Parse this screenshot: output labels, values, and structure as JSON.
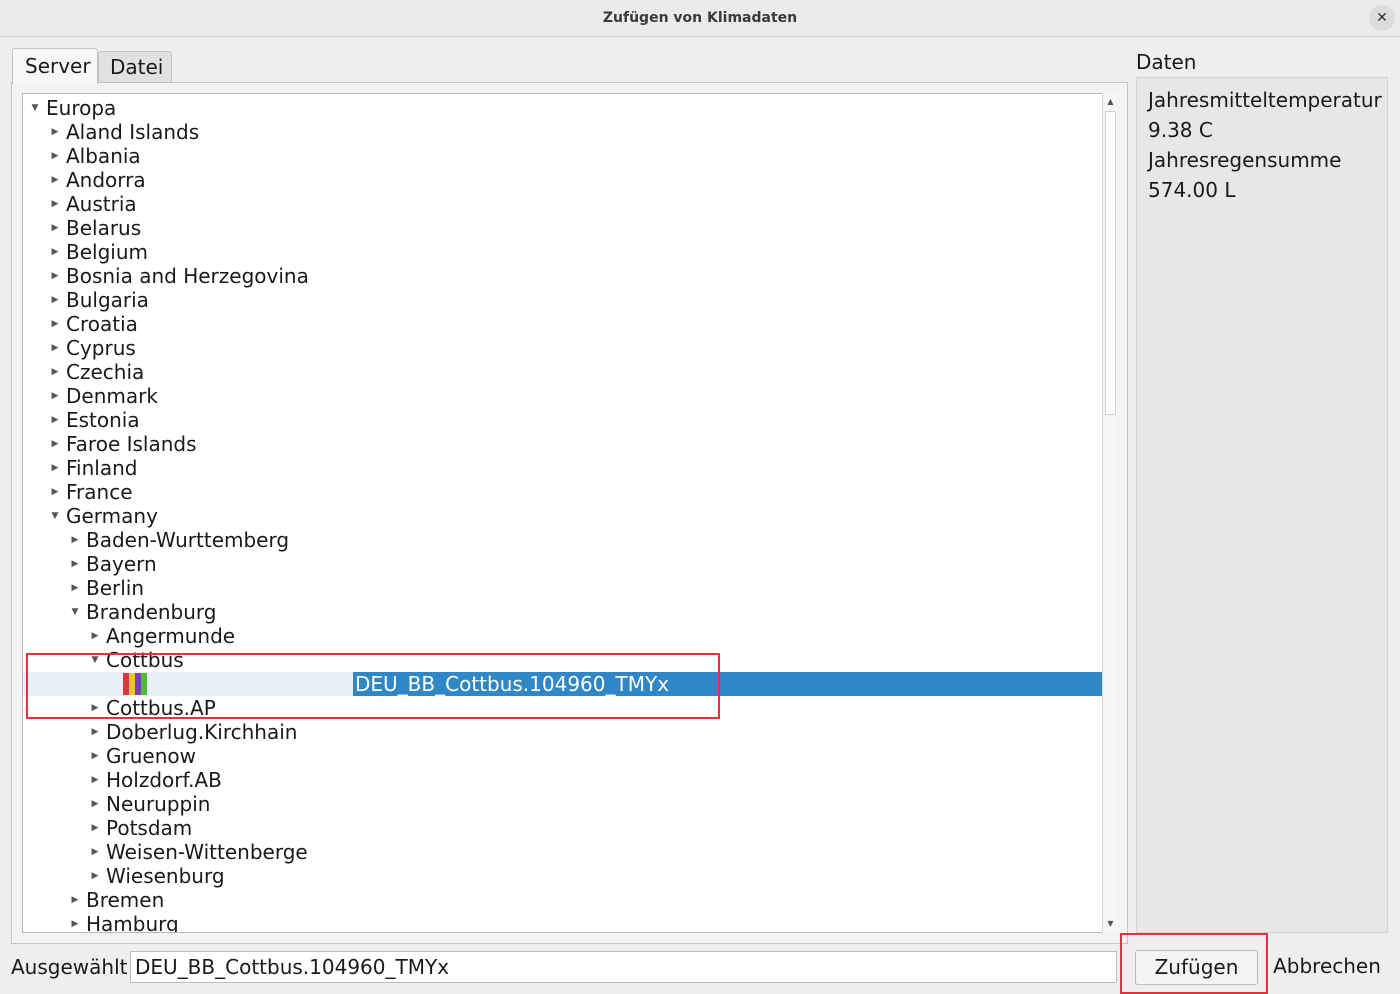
{
  "window": {
    "title": "Zufügen von Klimadaten",
    "close_icon": "close-icon"
  },
  "tabs": [
    {
      "label": "Server",
      "active": true
    },
    {
      "label": "Datei",
      "active": false
    }
  ],
  "tree": {
    "rows": [
      {
        "label": "Europa",
        "level": 0,
        "expanded": true
      },
      {
        "label": "Aland Islands",
        "level": 1,
        "expanded": false
      },
      {
        "label": "Albania",
        "level": 1,
        "expanded": false
      },
      {
        "label": "Andorra",
        "level": 1,
        "expanded": false
      },
      {
        "label": "Austria",
        "level": 1,
        "expanded": false
      },
      {
        "label": "Belarus",
        "level": 1,
        "expanded": false
      },
      {
        "label": "Belgium",
        "level": 1,
        "expanded": false
      },
      {
        "label": "Bosnia and Herzegovina",
        "level": 1,
        "expanded": false
      },
      {
        "label": "Bulgaria",
        "level": 1,
        "expanded": false
      },
      {
        "label": "Croatia",
        "level": 1,
        "expanded": false
      },
      {
        "label": "Cyprus",
        "level": 1,
        "expanded": false
      },
      {
        "label": "Czechia",
        "level": 1,
        "expanded": false
      },
      {
        "label": "Denmark",
        "level": 1,
        "expanded": false
      },
      {
        "label": "Estonia",
        "level": 1,
        "expanded": false
      },
      {
        "label": "Faroe Islands",
        "level": 1,
        "expanded": false
      },
      {
        "label": "Finland",
        "level": 1,
        "expanded": false
      },
      {
        "label": "France",
        "level": 1,
        "expanded": false
      },
      {
        "label": "Germany",
        "level": 1,
        "expanded": true
      },
      {
        "label": "Baden-Wurttemberg",
        "level": 2,
        "expanded": false
      },
      {
        "label": "Bayern",
        "level": 2,
        "expanded": false
      },
      {
        "label": "Berlin",
        "level": 2,
        "expanded": false
      },
      {
        "label": "Brandenburg",
        "level": 2,
        "expanded": true
      },
      {
        "label": "Angermunde",
        "level": 3,
        "expanded": false
      },
      {
        "label": "Cottbus",
        "level": 3,
        "expanded": true
      },
      {
        "label": "DEU_BB_Cottbus.104960_TMYx",
        "level": 4,
        "leaf": true,
        "selected": true
      },
      {
        "label": "Cottbus.AP",
        "level": 3,
        "expanded": false
      },
      {
        "label": "Doberlug.Kirchhain",
        "level": 3,
        "expanded": false
      },
      {
        "label": "Gruenow",
        "level": 3,
        "expanded": false
      },
      {
        "label": "Holzdorf.AB",
        "level": 3,
        "expanded": false
      },
      {
        "label": "Neuruppin",
        "level": 3,
        "expanded": false
      },
      {
        "label": "Potsdam",
        "level": 3,
        "expanded": false
      },
      {
        "label": "Weisen-Wittenberge",
        "level": 3,
        "expanded": false
      },
      {
        "label": "Wiesenburg",
        "level": 3,
        "expanded": false
      },
      {
        "label": "Bremen",
        "level": 2,
        "expanded": false
      },
      {
        "label": "Hamburg",
        "level": 2,
        "expanded": false
      }
    ],
    "leaf_color_stripes": [
      "#d83a3a",
      "#e7c82c",
      "#7b3fb4",
      "#52b83a"
    ]
  },
  "data_panel": {
    "heading": "Daten",
    "lines": [
      "Jahresmitteltemperatur",
      "9.38 C",
      "Jahresregensumme",
      "574.00 L"
    ]
  },
  "bottom": {
    "selected_label": "Ausgewählt",
    "selected_value": "DEU_BB_Cottbus.104960_TMYx",
    "add_button": "Zufügen",
    "cancel_button": "Abbrechen"
  },
  "colors": {
    "selection": "#2f87c7",
    "highlight_box": "#e0333f"
  }
}
